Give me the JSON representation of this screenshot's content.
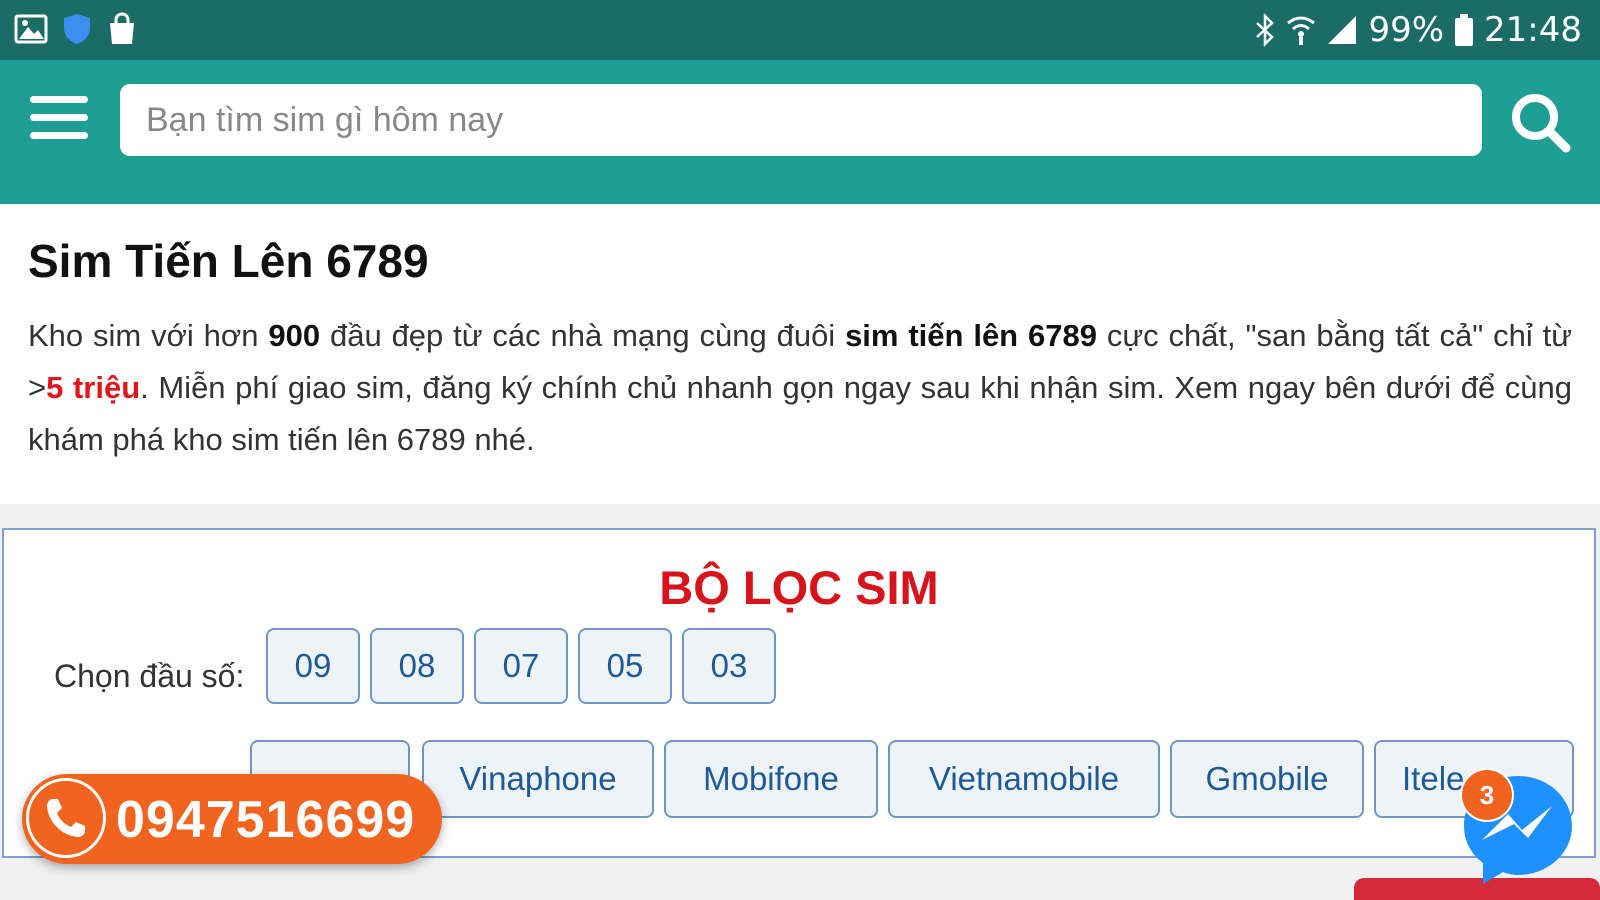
{
  "status_bar": {
    "battery": "99%",
    "time": "21:48",
    "left_icons": [
      "gallery-icon",
      "shield-icon",
      "shopping-bag-icon"
    ],
    "right_icons": [
      "bluetooth-icon",
      "wifi-icon",
      "signal-icon",
      "battery-icon"
    ]
  },
  "header": {
    "search_placeholder": "Bạn tìm sim gì hôm nay",
    "search_value": "",
    "icons": [
      "menu-icon",
      "search-icon"
    ]
  },
  "main": {
    "title": "Sim Tiến Lên 6789",
    "intro": {
      "p1": "Kho sim với hơn ",
      "b1": "900",
      "p2": " đầu đẹp từ các nhà mạng cùng đuôi ",
      "b2": "sim tiến lên 6789",
      "p3": " cực chất, \"san bằng tất cả\" chỉ từ >",
      "red": "5 triệu",
      "p4": ". Miễn phí giao sim, đăng ký chính chủ nhanh gọn ngay sau khi nhận sim. Xem ngay bên dưới để cùng khám phá kho sim tiến lên 6789 nhé."
    }
  },
  "filter": {
    "title": "BỘ LỌC SIM",
    "prefix_label": "Chọn đầu số:",
    "prefixes": [
      "09",
      "08",
      "07",
      "05",
      "03"
    ],
    "networks": [
      "Vinaphone",
      "Mobifone",
      "Vietnamobile",
      "Gmobile",
      "Itele"
    ]
  },
  "floating": {
    "phone": "0947516699",
    "messenger_badge": "3"
  },
  "colors": {
    "status_bar": "#1b6b66",
    "header": "#1f9e96",
    "accent_red": "#d7141b",
    "phone_orange": "#f1641f",
    "chip_border": "#6e97c9",
    "messenger_blue": "#1e90ff"
  }
}
